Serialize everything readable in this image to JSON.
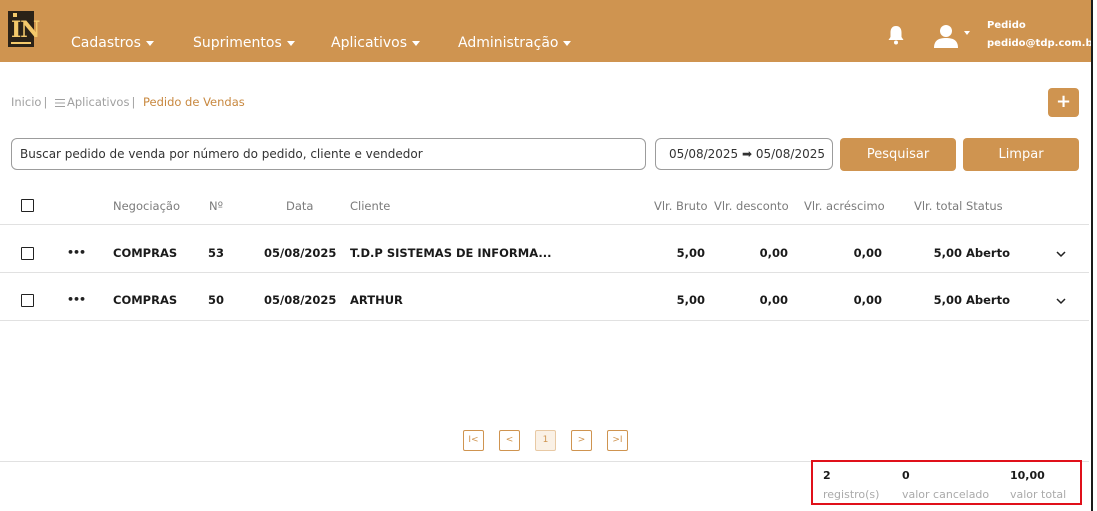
{
  "header": {
    "logo_text": "IN",
    "nav": [
      {
        "label": "Cadastros"
      },
      {
        "label": "Suprimentos"
      },
      {
        "label": "Aplicativos"
      },
      {
        "label": "Administração"
      }
    ],
    "user": {
      "name": "Pedido",
      "email": "pedido@tdp.com.br"
    },
    "icons": {
      "notifications": "bell-icon",
      "user": "user-icon"
    }
  },
  "breadcrumb": {
    "home": "Inicio",
    "section": "Aplicativos",
    "current": "Pedido de Vendas"
  },
  "actions": {
    "add_label": "+"
  },
  "search": {
    "placeholder": "Buscar pedido de venda por número do pedido, cliente e vendedor",
    "date_range": "05/08/2025 ➡ 05/08/2025",
    "search_label": "Pesquisar",
    "clear_label": "Limpar"
  },
  "table": {
    "columns": {
      "negociacao": "Negociação",
      "numero": "Nº",
      "data": "Data",
      "cliente": "Cliente",
      "vlr_bruto": "Vlr. Bruto",
      "vlr_desconto": "Vlr. desconto",
      "vlr_acrescimo": "Vlr. acréscimo",
      "vlr_total": "Vlr. total",
      "status": "Status"
    },
    "rows": [
      {
        "more": "•••",
        "negociacao": "COMPRAS",
        "numero": "53",
        "data": "05/08/2025",
        "cliente": "T.D.P SISTEMAS DE INFORMA...",
        "vlr_bruto": "5,00",
        "vlr_desconto": "0,00",
        "vlr_acrescimo": "0,00",
        "vlr_total": "5,00",
        "status": "Aberto"
      },
      {
        "more": "•••",
        "negociacao": "COMPRAS",
        "numero": "50",
        "data": "05/08/2025",
        "cliente": "ARTHUR",
        "vlr_bruto": "5,00",
        "vlr_desconto": "0,00",
        "vlr_acrescimo": "0,00",
        "vlr_total": "5,00",
        "status": "Aberto"
      }
    ]
  },
  "pagination": {
    "first": "I<",
    "prev": "<",
    "current": "1",
    "next": ">",
    "last": ">I"
  },
  "summary": {
    "registros_value": "2",
    "registros_label": "registro(s)",
    "cancelado_value": "0",
    "cancelado_label": "valor cancelado",
    "total_value": "10,00",
    "total_label": "valor total"
  },
  "colors": {
    "brand": "#cf9450",
    "highlight_border": "#e0101a"
  }
}
